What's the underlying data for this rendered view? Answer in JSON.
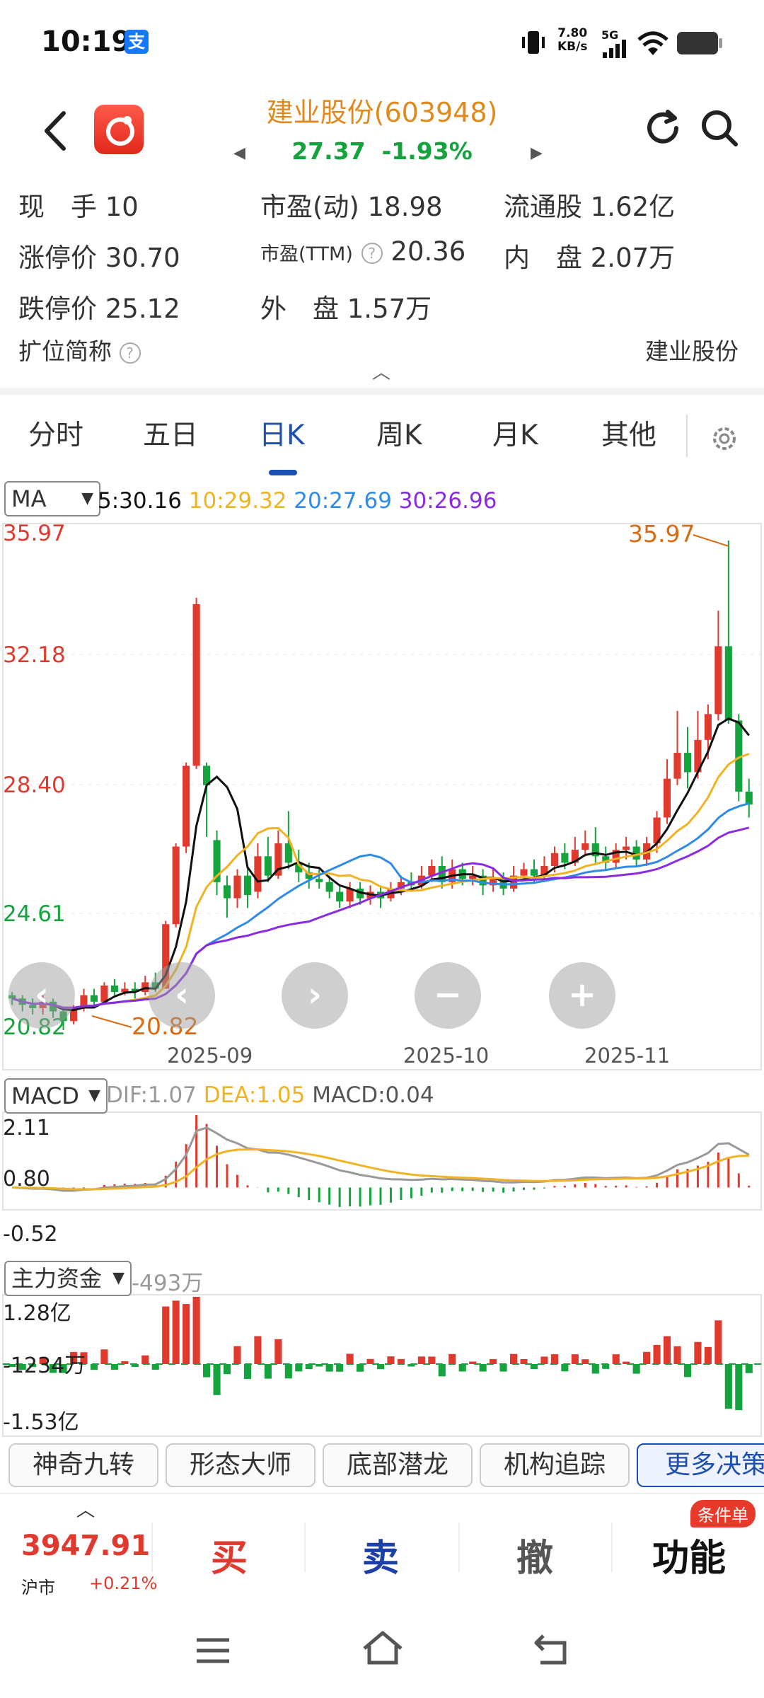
{
  "status_bar": {
    "time": "10:19",
    "app_icon_glyph": "支",
    "net_speed_value": "7.80",
    "net_speed_unit": "KB/s",
    "signal": "5G",
    "icons": [
      "vibrate-icon",
      "signal-icon",
      "wifi-icon",
      "battery-icon"
    ]
  },
  "header": {
    "title": "建业股份(603948)",
    "price": "27.37",
    "change_pct": "-1.93%",
    "price_color": "#15a33d",
    "title_color": "#e08a1e"
  },
  "quote": {
    "xian_shou_label": "现　手",
    "xian_shou_value": "10",
    "pe_dyn_label": "市盈(动)",
    "pe_dyn_value": "18.98",
    "float_label": "流通股",
    "float_value": "1.62亿",
    "limit_up_label": "涨停价",
    "limit_up_value": "30.70",
    "pe_ttm_label": "市盈(TTM)",
    "pe_ttm_value": "20.36",
    "inner_label": "内　盘",
    "inner_value": "2.07万",
    "limit_down_label": "跌停价",
    "limit_down_value": "25.12",
    "outer_label": "外　盘",
    "outer_value": "1.57万",
    "alias_label": "扩位简称",
    "alias_value": "建业股份"
  },
  "tabs": [
    "分时",
    "五日",
    "日K",
    "周K",
    "月K",
    "其他"
  ],
  "active_tab": "日K",
  "ma": {
    "selector": "MA",
    "ma5": "5:30.16",
    "ma10": "10:29.32",
    "ma20": "20:27.69",
    "ma30": "30:26.96",
    "colors": {
      "ma5": "#111111",
      "ma10": "#f0b323",
      "ma20": "#2f8be8",
      "ma30": "#8a2be2"
    }
  },
  "kline": {
    "y_labels": [
      "35.97",
      "32.18",
      "28.40",
      "24.61",
      "20.82"
    ],
    "high_marker": "35.97",
    "low_marker": "20.82",
    "x_labels": [
      "2025-09",
      "2025-10",
      "2025-11"
    ]
  },
  "macd": {
    "selector": "MACD",
    "dif": "DIF:1.07",
    "dea": "DEA:1.05",
    "macd": "MACD:0.04",
    "y_labels": [
      "2.11",
      "0.80",
      "-0.52"
    ]
  },
  "flow": {
    "selector": "主力资金",
    "value": "-493万",
    "y_labels": [
      "1.28亿",
      "-1234万",
      "-1.53亿"
    ]
  },
  "strategies": [
    "神奇九转",
    "形态大师",
    "底部潜龙",
    "机构追踪",
    "更多决策"
  ],
  "trade": {
    "index_value": "3947.91",
    "index_name": "沪市",
    "index_change": "+0.21%",
    "buy": "买",
    "sell": "卖",
    "cancel": "撤",
    "func": "功能",
    "badge": "条件单"
  },
  "chart_data": {
    "type": "candlestick",
    "x_ticks": [
      "2025-09",
      "2025-10",
      "2025-11"
    ],
    "ylim": [
      20.82,
      35.97
    ],
    "y_ticks": [
      35.97,
      32.18,
      28.4,
      24.61,
      20.82
    ],
    "candles": [
      [
        21.9,
        21.8,
        22.0,
        21.6
      ],
      [
        21.8,
        21.6,
        21.9,
        21.4
      ],
      [
        21.6,
        21.5,
        21.8,
        21.3
      ],
      [
        21.5,
        21.7,
        21.9,
        21.3
      ],
      [
        21.7,
        21.4,
        21.8,
        21.2
      ],
      [
        21.4,
        21.1,
        21.5,
        20.82
      ],
      [
        21.1,
        21.5,
        21.6,
        21.0
      ],
      [
        21.5,
        21.9,
        22.1,
        21.4
      ],
      [
        21.9,
        21.7,
        22.1,
        21.6
      ],
      [
        21.7,
        22.2,
        22.3,
        21.6
      ],
      [
        22.2,
        22.0,
        22.4,
        21.9
      ],
      [
        22.0,
        22.1,
        22.3,
        21.9
      ],
      [
        22.1,
        22.0,
        22.3,
        21.8
      ],
      [
        22.0,
        22.3,
        22.5,
        21.9
      ],
      [
        22.3,
        22.1,
        22.6,
        22.0
      ],
      [
        22.1,
        24.1,
        24.2,
        22.1
      ],
      [
        24.1,
        26.5,
        26.6,
        24.0
      ],
      [
        26.5,
        29.0,
        29.1,
        26.3
      ],
      [
        29.0,
        34.0,
        34.2,
        28.9
      ],
      [
        29.0,
        28.4,
        29.1,
        26.8
      ],
      [
        26.7,
        25.4,
        27.0,
        25.0
      ],
      [
        25.3,
        24.9,
        25.6,
        24.3
      ],
      [
        24.9,
        25.6,
        25.8,
        24.6
      ],
      [
        25.6,
        25.0,
        25.9,
        24.6
      ],
      [
        25.1,
        26.2,
        26.6,
        24.9
      ],
      [
        26.2,
        25.6,
        26.8,
        25.4
      ],
      [
        25.6,
        26.6,
        27.0,
        25.5
      ],
      [
        26.6,
        26.0,
        27.6,
        25.8
      ],
      [
        26.0,
        25.7,
        26.4,
        25.4
      ],
      [
        25.7,
        25.5,
        26.0,
        25.2
      ],
      [
        25.5,
        25.4,
        25.8,
        25.2
      ],
      [
        25.4,
        25.1,
        25.6,
        24.9
      ],
      [
        25.1,
        24.8,
        25.3,
        24.6
      ],
      [
        24.8,
        25.2,
        25.4,
        24.6
      ],
      [
        25.2,
        24.9,
        25.4,
        24.7
      ],
      [
        24.9,
        25.1,
        25.3,
        24.7
      ],
      [
        25.1,
        24.9,
        25.3,
        24.6
      ],
      [
        24.9,
        25.2,
        25.4,
        24.8
      ],
      [
        25.2,
        25.4,
        25.6,
        25.0
      ],
      [
        25.4,
        25.3,
        25.7,
        25.1
      ],
      [
        25.3,
        25.6,
        25.9,
        25.2
      ],
      [
        25.6,
        25.9,
        26.1,
        25.4
      ],
      [
        25.9,
        25.4,
        26.2,
        25.2
      ],
      [
        25.4,
        25.8,
        26.1,
        25.2
      ],
      [
        25.8,
        25.5,
        26.0,
        25.3
      ],
      [
        25.5,
        25.6,
        25.9,
        25.3
      ],
      [
        25.6,
        25.3,
        25.8,
        25.0
      ],
      [
        25.3,
        25.5,
        25.8,
        25.1
      ],
      [
        25.5,
        25.2,
        25.7,
        25.0
      ],
      [
        25.2,
        25.6,
        25.9,
        25.1
      ],
      [
        25.6,
        25.8,
        26.0,
        25.5
      ],
      [
        25.8,
        25.6,
        26.1,
        25.4
      ],
      [
        25.6,
        25.9,
        26.2,
        25.4
      ],
      [
        25.9,
        26.3,
        26.5,
        25.7
      ],
      [
        26.3,
        26.0,
        26.6,
        25.8
      ],
      [
        26.0,
        26.4,
        26.8,
        25.9
      ],
      [
        26.4,
        26.6,
        27.0,
        26.2
      ],
      [
        26.6,
        26.2,
        27.1,
        26.0
      ],
      [
        26.2,
        26.0,
        26.5,
        25.8
      ],
      [
        26.0,
        26.4,
        26.6,
        25.8
      ],
      [
        26.4,
        26.5,
        26.8,
        26.1
      ],
      [
        26.5,
        26.1,
        26.7,
        25.9
      ],
      [
        26.1,
        26.6,
        26.8,
        25.9
      ],
      [
        26.6,
        27.4,
        27.6,
        26.3
      ],
      [
        27.4,
        28.6,
        29.2,
        27.2
      ],
      [
        28.6,
        29.4,
        30.7,
        28.4
      ],
      [
        29.4,
        28.8,
        30.2,
        28.3
      ],
      [
        28.8,
        29.8,
        30.7,
        28.6
      ],
      [
        29.8,
        30.6,
        30.9,
        29.2
      ],
      [
        30.6,
        32.7,
        33.8,
        30.4
      ],
      [
        32.7,
        30.4,
        35.97,
        30.3
      ],
      [
        30.4,
        28.2,
        30.6,
        27.9
      ],
      [
        28.2,
        27.8,
        28.6,
        27.4
      ]
    ]
  }
}
